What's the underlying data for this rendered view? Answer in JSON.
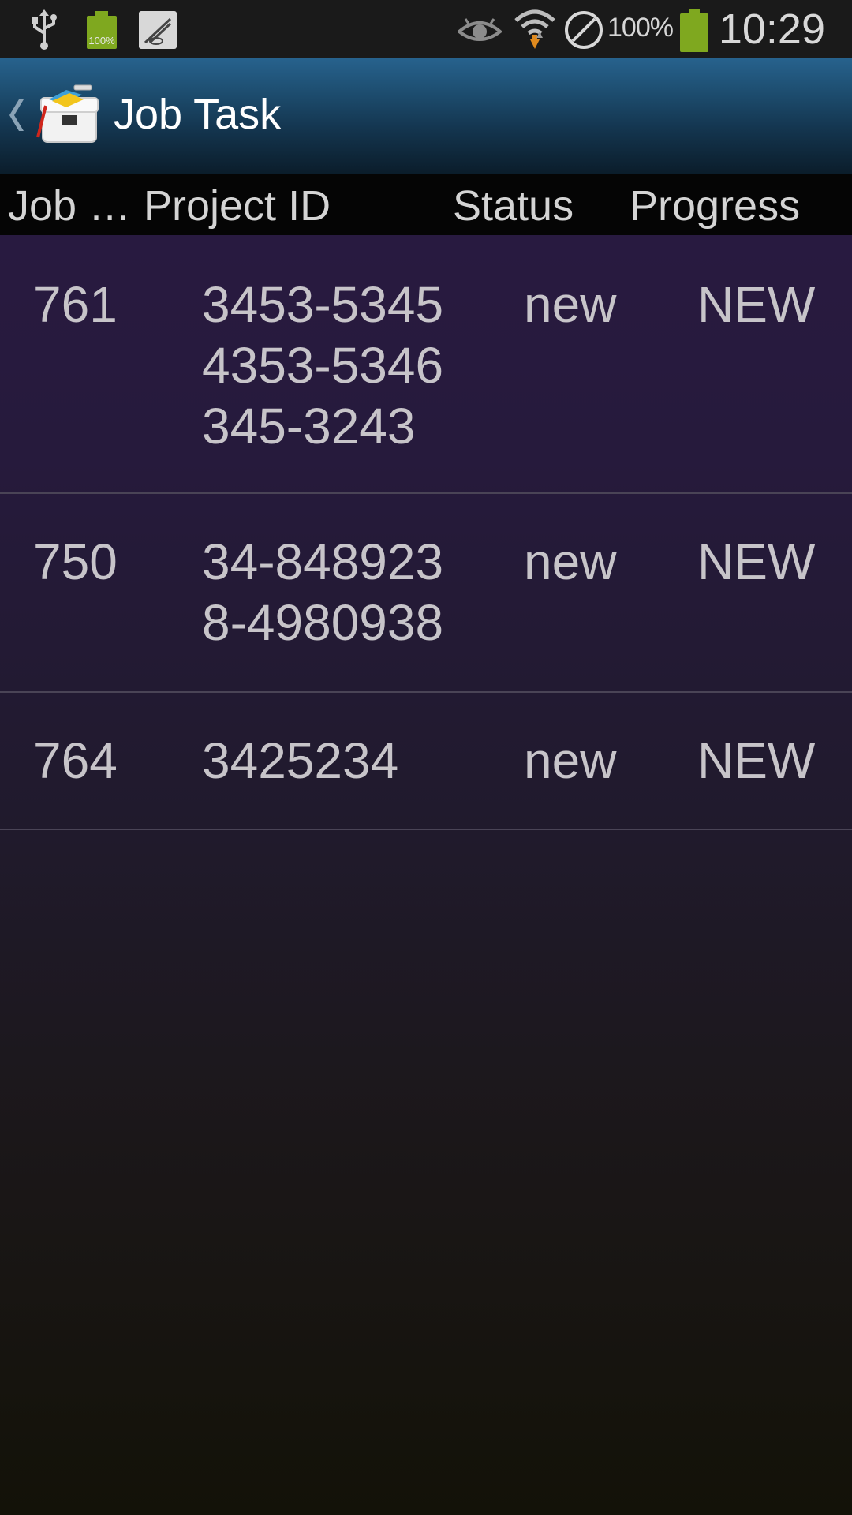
{
  "status_bar": {
    "notification_icons": [
      "usb-icon",
      "battery-icon",
      "app-icon"
    ],
    "battery_notification_text": "100%",
    "system_icons": [
      "eye-icon",
      "wifi-icon",
      "do-not-disturb-icon",
      "battery-icon"
    ],
    "battery_percent": "100%",
    "time": "10:29"
  },
  "action_bar": {
    "title": "Job Task",
    "icon": "toolbox-icon",
    "back_icon": "chevron-left-icon"
  },
  "table": {
    "headers": {
      "job": "Job …",
      "project_id": "Project ID",
      "status": "Status",
      "progress": "Progress"
    },
    "rows": [
      {
        "job": "761",
        "project_ids": [
          "3453-5345",
          "4353-5346",
          "345-3243"
        ],
        "status": "new",
        "progress": "NEW"
      },
      {
        "job": "750",
        "project_ids": [
          "34-848923",
          "8-4980938"
        ],
        "status": "new",
        "progress": "NEW"
      },
      {
        "job": "764",
        "project_ids": [
          "3425234"
        ],
        "status": "new",
        "progress": "NEW"
      }
    ]
  },
  "colors": {
    "action_bar_top": "#27628d",
    "action_bar_bottom": "#0b1d2b",
    "battery_green": "#7fa81f",
    "background_top": "#2b1a44",
    "background_bottom": "#131208",
    "text": "#c7c4c9"
  }
}
